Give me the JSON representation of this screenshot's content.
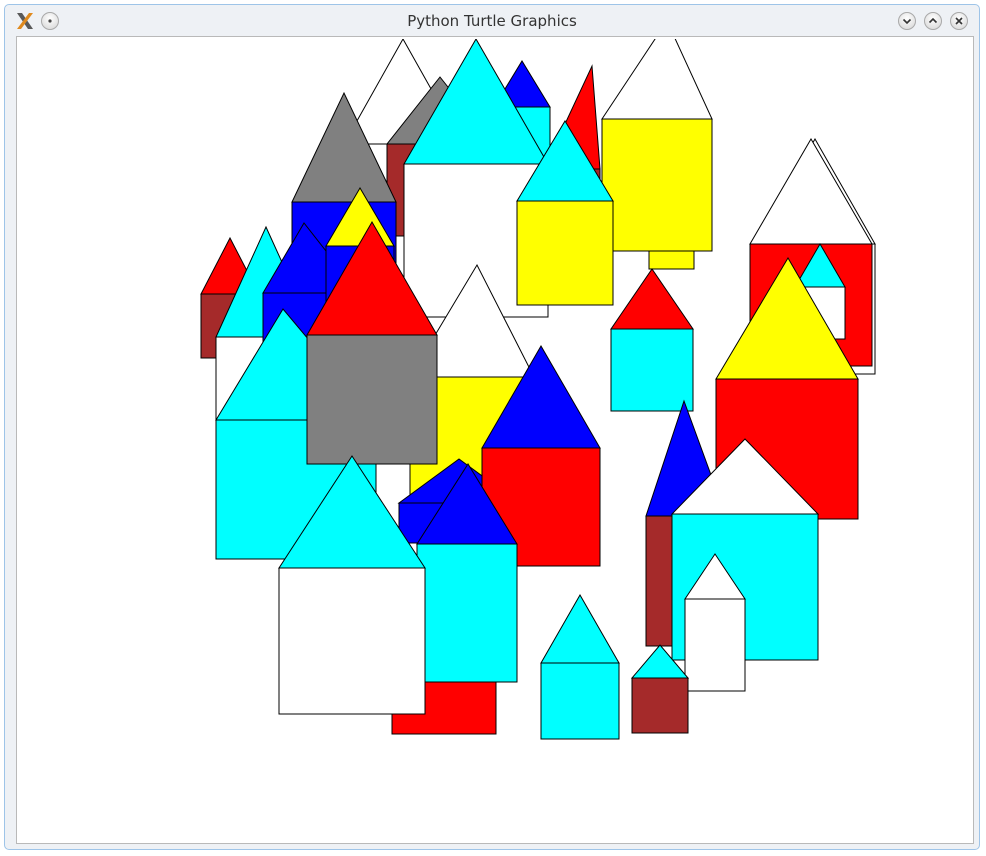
{
  "window": {
    "title": "Python Turtle Graphics",
    "app_icon": "x-logo-icon",
    "controls": [
      {
        "name": "menu",
        "icon": "dot-icon"
      },
      {
        "name": "minimize",
        "icon": "chevron-down-icon"
      },
      {
        "name": "maximize",
        "icon": "chevron-up-icon"
      },
      {
        "name": "close",
        "icon": "close-icon"
      }
    ]
  },
  "canvas": {
    "background": "#ffffff",
    "outline_color": "#000000"
  },
  "palette": {
    "white": "#ffffff",
    "cyan": "#00ffff",
    "red": "#ff0000",
    "blue": "#0000ff",
    "yellow": "#ffff00",
    "gray": "#808080",
    "brown": "#a52a2a"
  },
  "houses": [
    {
      "body": "white",
      "roof": "white"
    },
    {
      "body": "brown",
      "roof": "gray"
    },
    {
      "body": "cyan",
      "roof": "blue"
    },
    {
      "body": "brown",
      "roof": "red"
    },
    {
      "body": "yellow",
      "roof": "white"
    },
    {
      "body": "yellow",
      "roof": "white"
    },
    {
      "body": "white",
      "roof": "cyan"
    },
    {
      "body": "blue",
      "roof": "gray"
    },
    {
      "body": "yellow",
      "roof": "cyan"
    },
    {
      "body": "white",
      "roof": "white"
    },
    {
      "body": "red",
      "roof": "white"
    },
    {
      "body": "white",
      "roof": "cyan"
    },
    {
      "body": "brown",
      "roof": "red"
    },
    {
      "body": "white",
      "roof": "cyan"
    },
    {
      "body": "blue",
      "roof": "blue"
    },
    {
      "body": "blue",
      "roof": "yellow"
    },
    {
      "body": "cyan",
      "roof": "red"
    },
    {
      "body": "cyan",
      "roof": "cyan"
    },
    {
      "body": "yellow",
      "roof": "white"
    },
    {
      "body": "gray",
      "roof": "red"
    },
    {
      "body": "blue",
      "roof": "blue"
    },
    {
      "body": "red",
      "roof": "blue"
    },
    {
      "body": "brown",
      "roof": "blue"
    },
    {
      "body": "red",
      "roof": "yellow"
    },
    {
      "body": "cyan",
      "roof": "white"
    },
    {
      "body": "white",
      "roof": "white"
    },
    {
      "body": "red",
      "roof": "blue"
    },
    {
      "body": "cyan",
      "roof": "blue"
    },
    {
      "body": "white",
      "roof": "cyan"
    },
    {
      "body": "cyan",
      "roof": "cyan"
    },
    {
      "body": "brown",
      "roof": "cyan"
    }
  ]
}
